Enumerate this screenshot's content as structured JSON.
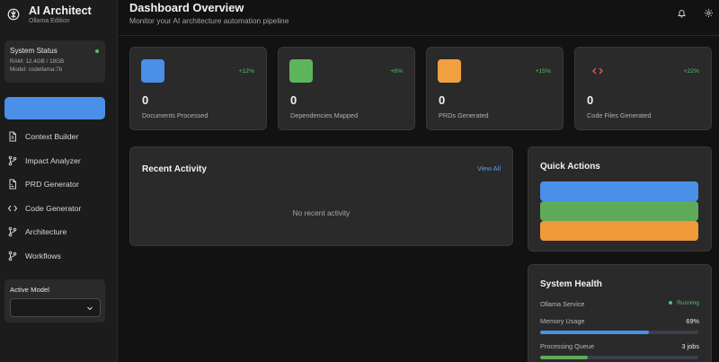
{
  "sidebar": {
    "brand_title": "AI Architect",
    "brand_subtitle": "Ollama Edition",
    "status": {
      "title": "System Status",
      "ram": "RAM: 12.4GB / 18GB",
      "model": "Model: codellama:7b",
      "dot_color": "#4cc26f"
    },
    "primary_button_color": "#4a8fe8",
    "nav": [
      {
        "label": "Context Builder",
        "icon": "document-icon"
      },
      {
        "label": "Impact Analyzer",
        "icon": "git-branch-icon"
      },
      {
        "label": "PRD Generator",
        "icon": "file-text-icon"
      },
      {
        "label": "Code Generator",
        "icon": "code-icon"
      },
      {
        "label": "Architecture",
        "icon": "git-branch-icon"
      },
      {
        "label": "Workflows",
        "icon": "git-branch-icon"
      }
    ],
    "active_model": {
      "label": "Active Model",
      "value": ""
    }
  },
  "header": {
    "title": "Dashboard Overview",
    "subtitle": "Monitor your AI architecture automation pipeline",
    "icons": [
      "bell-icon",
      "gear-icon"
    ]
  },
  "stats": [
    {
      "value": "0",
      "label": "Documents Processed",
      "change": "+12%",
      "color": "#4a8fe8"
    },
    {
      "value": "0",
      "label": "Dependencies Mapped",
      "change": "+8%",
      "color": "#5cb55c"
    },
    {
      "value": "0",
      "label": "PRDs Generated",
      "change": "+15%",
      "color": "#f0a040"
    },
    {
      "value": "0",
      "label": "Code Files Generated",
      "change": "+22%",
      "icon": "code-icon",
      "icon_color": "#e85a5a"
    }
  ],
  "recent_activity": {
    "title": "Recent Activity",
    "view_all": "View All",
    "empty": "No recent activity"
  },
  "quick_actions": {
    "title": "Quick Actions",
    "button_colors": [
      "#4a8fe8",
      "#5faa5a",
      "#f09a3a"
    ]
  },
  "system_health": {
    "title": "System Health",
    "ollama": {
      "label": "Ollama Service",
      "status": "Running"
    },
    "memory": {
      "label": "Memory Usage",
      "value": "69%",
      "fraction": 0.69,
      "color": "#4a8fe8"
    },
    "queue": {
      "label": "Processing Queue",
      "value": "3 jobs",
      "fraction": 0.3,
      "color": "#5faa5a"
    }
  }
}
